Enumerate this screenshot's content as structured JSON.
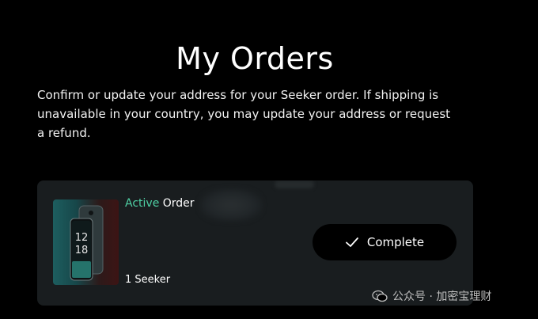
{
  "header": {
    "title": "My Orders",
    "description": "Confirm or update your address for your Seeker order. If shipping is unavailable in your country, you may update your address or request a refund."
  },
  "order": {
    "status_label": "Active",
    "status_suffix": "Order",
    "quantity": "1 Seeker",
    "action_label": "Complete",
    "product_image": "seeker-phone-image",
    "phone_screen_text": [
      "12",
      "18"
    ]
  },
  "colors": {
    "background": "#000000",
    "card": "#191d1f",
    "accent_active": "#4fd1a5",
    "button": "#000000"
  },
  "watermark": {
    "icon": "wechat-icon",
    "text": "公众号 · 加密宝理财"
  }
}
